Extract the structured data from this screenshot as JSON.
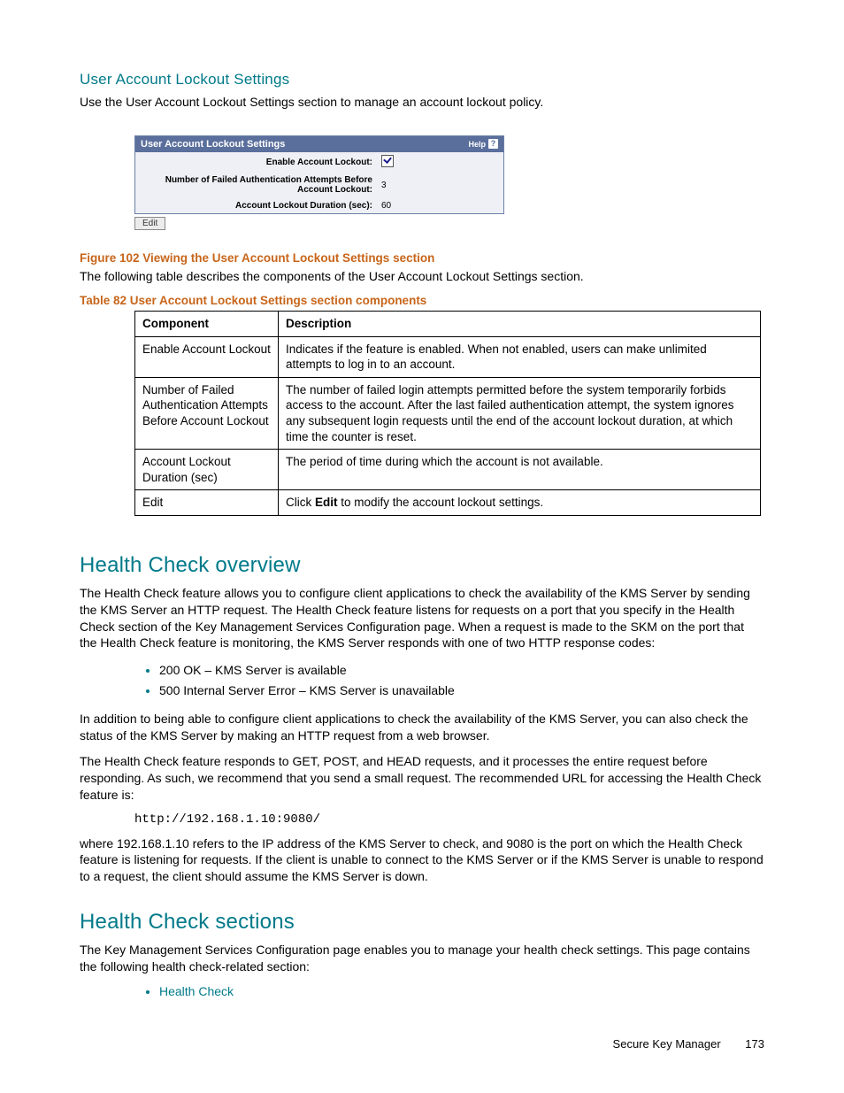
{
  "section1": {
    "heading": "User Account Lockout Settings",
    "intro": "Use the User Account Lockout Settings section to manage an account lockout policy."
  },
  "panel": {
    "title": "User Account Lockout Settings",
    "help_label": "Help",
    "rows": {
      "enable_label": "Enable Account Lockout:",
      "attempts_label": "Number of Failed Authentication Attempts Before Account Lockout:",
      "attempts_value": "3",
      "duration_label": "Account Lockout Duration (sec):",
      "duration_value": "60"
    },
    "edit_label": "Edit"
  },
  "figure_caption": "Figure 102 Viewing the User Account Lockout Settings section",
  "table_intro": "The following table describes the components of the User Account Lockout Settings section.",
  "table_caption": "Table 82 User Account Lockout Settings section components",
  "table": {
    "h1": "Component",
    "h2": "Description",
    "rows": [
      {
        "c": "Enable Account Lockout",
        "d": "Indicates if the feature is enabled. When not enabled, users can make unlimited attempts to log in to an account."
      },
      {
        "c": "Number of Failed Authentication Attempts Before Account Lockout",
        "d": "The number of failed login attempts permitted before the system temporarily forbids access to the account. After the last failed authentication attempt, the system ignores any subsequent login requests until the end of the account lockout duration, at which time the counter is reset."
      },
      {
        "c": "Account Lockout Duration (sec)",
        "d": "The period of time during which the account is not available."
      },
      {
        "c": "Edit",
        "d_pre": "Click ",
        "d_bold": "Edit",
        "d_post": " to modify the account lockout settings."
      }
    ]
  },
  "health_overview": {
    "heading": "Health Check overview",
    "p1": "The Health Check feature allows you to configure client applications to check the availability of the KMS Server by sending the KMS Server an HTTP request. The Health Check feature listens for requests on a port that you specify in the Health Check section of the Key Management Services Configuration page. When a request is made to the SKM on the port that the Health Check feature is monitoring, the KMS Server responds with one of two HTTP response codes:",
    "bullets": [
      "200 OK – KMS Server is available",
      "500 Internal Server Error – KMS Server is unavailable"
    ],
    "p2": "In addition to being able to configure client applications to check the availability of the KMS Server, you can also check the status of the KMS Server by making an HTTP request from a web browser.",
    "p3": "The Health Check feature responds to GET, POST, and HEAD requests, and it processes the entire request before responding. As such, we recommend that you send a small request. The recommended URL for accessing the Health Check feature is:",
    "url": "http://192.168.1.10:9080/",
    "p4": "where 192.168.1.10 refers to the IP address of the KMS Server to check, and 9080 is the port on which the Health Check feature is listening for requests. If the client is unable to connect to the KMS Server or if the KMS Server is unable to respond to a request, the client should assume the KMS Server is down."
  },
  "health_sections": {
    "heading": "Health Check sections",
    "p1": "The Key Management Services Configuration page enables you to manage your health check settings. This page contains the following health check-related section:",
    "links": [
      "Health Check"
    ]
  },
  "footer": {
    "title": "Secure Key Manager",
    "page": "173"
  }
}
